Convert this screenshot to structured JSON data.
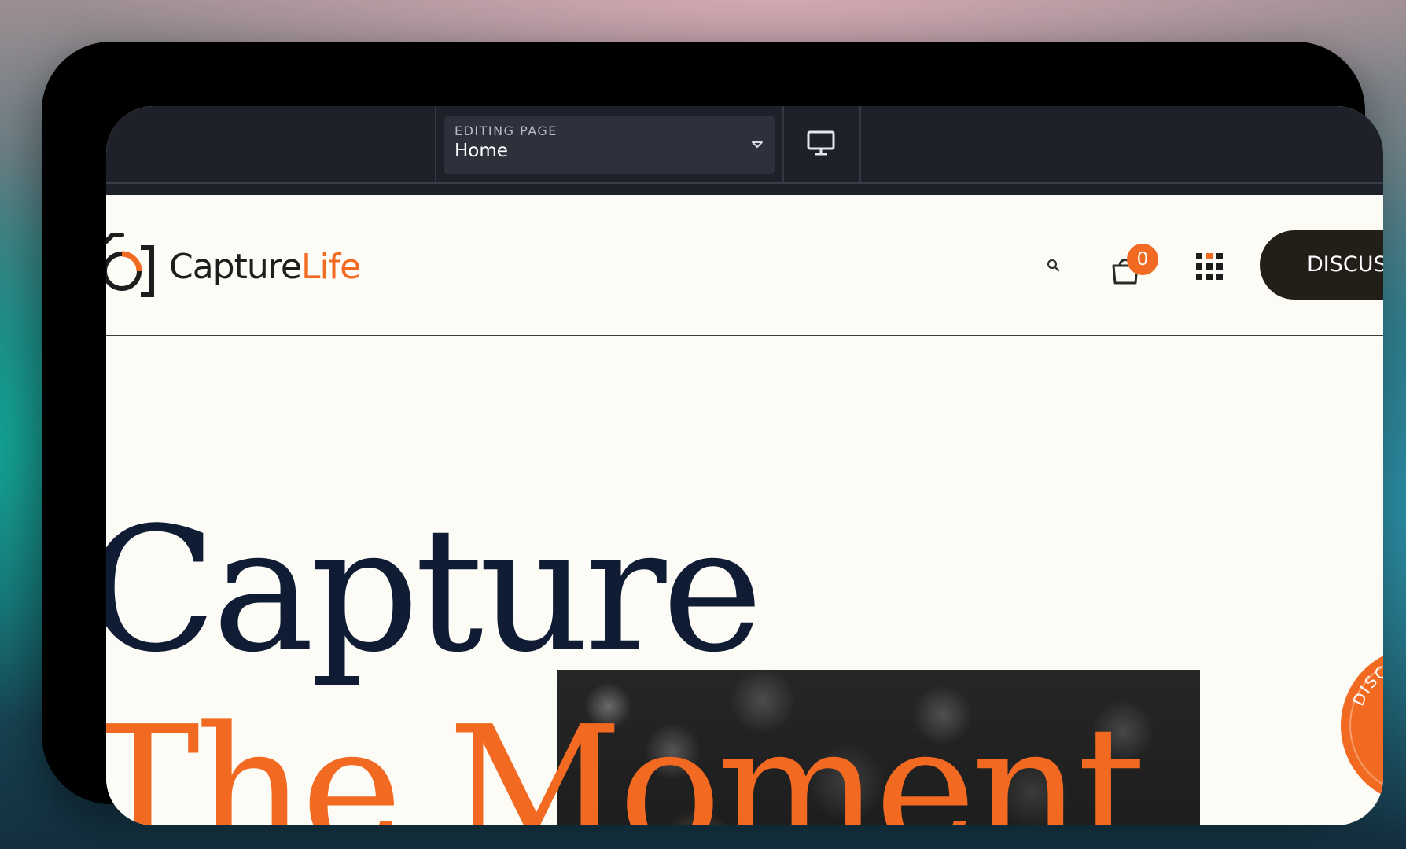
{
  "editor": {
    "page_label": "EDITING PAGE",
    "page_value": "Home",
    "caret_icon": "caret-down-icon",
    "device_icon": "desktop-monitor-icon"
  },
  "site": {
    "logo": {
      "word_dark": "Capture",
      "word_accent": "Life",
      "icon": "camera-logo-icon"
    },
    "header": {
      "search_icon": "search-icon",
      "cart_icon": "shopping-bag-icon",
      "cart_count": "0",
      "menu_icon": "grid-menu-icon",
      "cta_label": "DISCUSS"
    },
    "hero": {
      "title_line1": "Capture",
      "title_line2": "The Moment",
      "seal_text": "DISCUSS THE PR"
    }
  },
  "colors": {
    "accent": "#f26a21",
    "navy": "#0f1c33",
    "editor_bg": "#1e2129",
    "page_bg": "#fcfbf6",
    "cta_bg": "#221f18"
  }
}
